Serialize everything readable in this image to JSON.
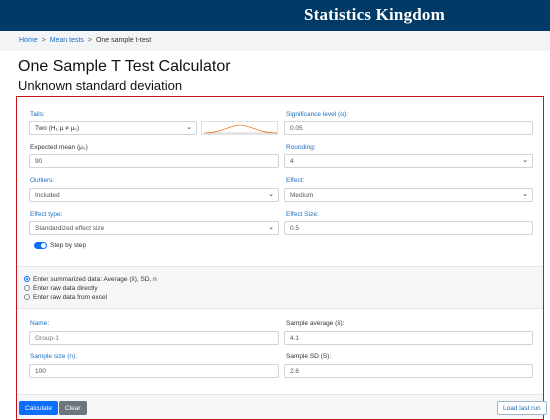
{
  "header": {
    "site_title": "Statistics Kingdom"
  },
  "breadcrumb": {
    "home": "Home",
    "mean_tests": "Mean tests",
    "current": "One sample t-test",
    "sep": ">"
  },
  "page": {
    "title": "One Sample T Test Calculator",
    "subtitle": "Unknown standard deviation"
  },
  "form": {
    "tails": {
      "label": "Tails:",
      "value": "Two (H₁:μ ≠ μ₀)"
    },
    "significance": {
      "label": "Significance level (α):",
      "value": "0.05"
    },
    "expected_mean": {
      "label": "Expected mean (μ₀)",
      "value": "90"
    },
    "rounding": {
      "label": "Rounding:",
      "value": "4"
    },
    "outliers": {
      "label": "Outliers:",
      "value": "Included"
    },
    "effect": {
      "label": "Effect:",
      "value": "Medium"
    },
    "effect_type": {
      "label": "Effect type:",
      "value": "Standardized effect size"
    },
    "effect_size": {
      "label": "Effect Size:",
      "value": "0.5"
    },
    "step_by_step": {
      "label": "Step by step",
      "checked": true
    }
  },
  "data_entry": {
    "options": [
      {
        "label": "Enter summarized data: Average (x̄), SD, n",
        "checked": true
      },
      {
        "label": "Enter raw data directly",
        "checked": false
      },
      {
        "label": "Enter raw data from excel",
        "checked": false
      }
    ]
  },
  "summary": {
    "name": {
      "label": "Name:",
      "placeholder": "Group-1"
    },
    "sample_average": {
      "label": "Sample average (x̄):",
      "value": "4.1"
    },
    "sample_size": {
      "label": "Sample size (n):",
      "value": "100"
    },
    "sample_sd": {
      "label": "Sample SD (S):",
      "value": "2.6"
    }
  },
  "actions": {
    "calculate": "Calculate",
    "clear": "Clear",
    "load_last_run": "Load last run"
  },
  "icons": {
    "dropdown": "chevron-down-icon",
    "distribution": "distribution-curve-icon"
  },
  "colors": {
    "header_bg": "#003a66",
    "accent": "#0d6efd",
    "panel_border": "#c8121c",
    "label_blue": "#1a6fbf"
  }
}
